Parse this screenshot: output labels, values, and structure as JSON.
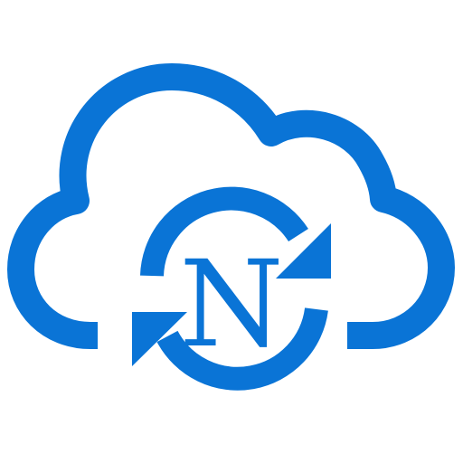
{
  "icon": {
    "name": "cloud-sync-icon",
    "letter": "N",
    "color": "#0a74d6",
    "background": "#ffffff"
  }
}
